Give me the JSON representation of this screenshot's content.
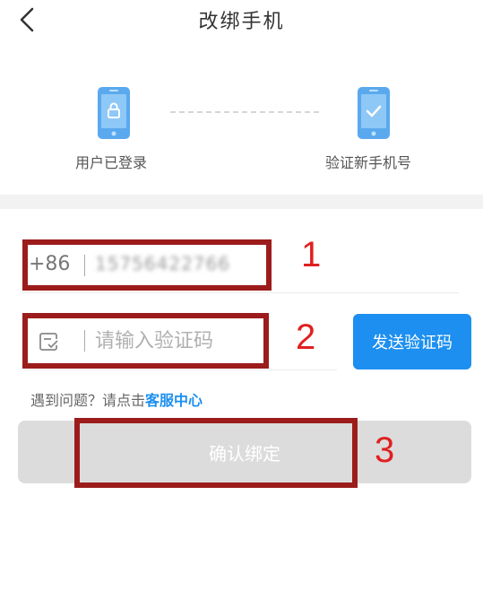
{
  "header": {
    "title": "改绑手机"
  },
  "steps": [
    {
      "label": "用户已登录",
      "icon": "phone-lock-icon"
    },
    {
      "label": "验证新手机号",
      "icon": "phone-check-icon"
    }
  ],
  "phone_field": {
    "country_code": "+86",
    "value_blurred": "15756422766"
  },
  "code_field": {
    "icon": "verify-code-icon",
    "placeholder": "请输入验证码",
    "value": ""
  },
  "send_code_button": {
    "label": "发送验证码"
  },
  "help": {
    "prefix": "遇到问题？请点击",
    "link": "客服中心"
  },
  "confirm_button": {
    "label": "确认绑定"
  },
  "annotations": [
    {
      "number": "1"
    },
    {
      "number": "2"
    },
    {
      "number": "3"
    }
  ],
  "colors": {
    "accent": "#1c8ff0",
    "annotation_box": "#9c1c1c",
    "annotation_number": "#e02020",
    "disabled_button": "#dcdcdc"
  }
}
